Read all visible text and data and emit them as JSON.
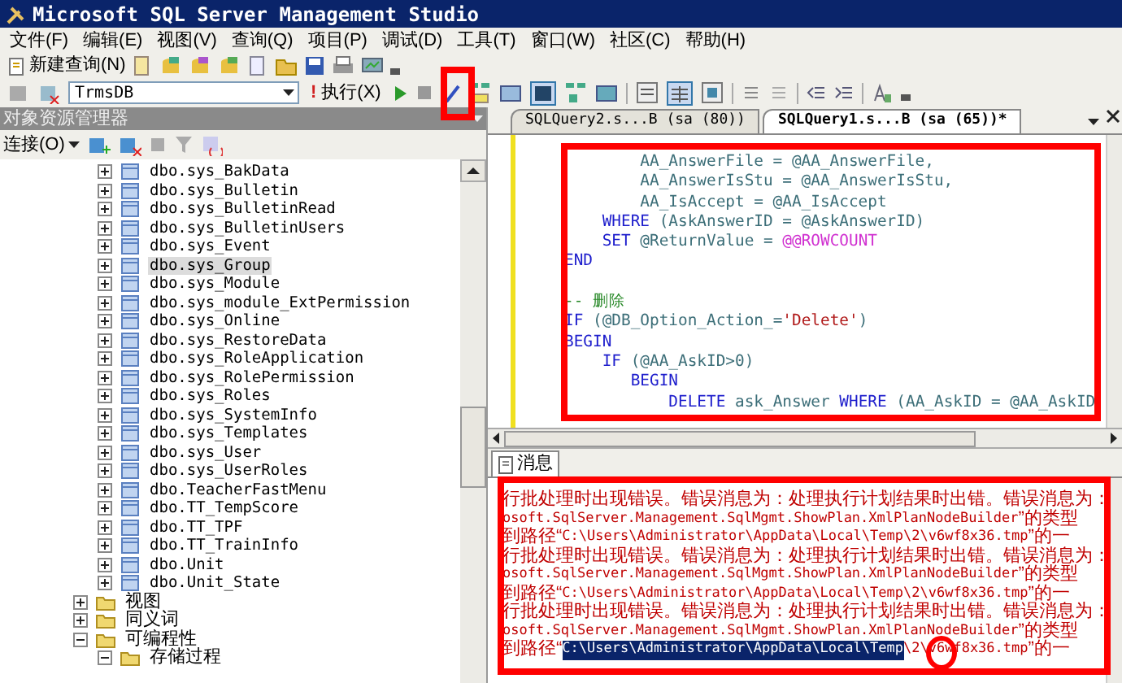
{
  "window": {
    "title": "Microsoft SQL Server Management Studio"
  },
  "menu": [
    "文件(F)",
    "编辑(E)",
    "视图(V)",
    "查询(Q)",
    "项目(P)",
    "调试(D)",
    "工具(T)",
    "窗口(W)",
    "社区(C)",
    "帮助(H)"
  ],
  "toolbar": {
    "new_query": "新建查询(N)",
    "database": "TrmsDB",
    "execute_mark": "!",
    "execute": "执行(X)"
  },
  "object_explorer": {
    "title": "对象资源管理器",
    "connect": "连接(O)",
    "tables": [
      {
        "label": "dbo.sys_BakData",
        "expanded": false,
        "selected": false
      },
      {
        "label": "dbo.sys_Bulletin",
        "expanded": false,
        "selected": false
      },
      {
        "label": "dbo.sys_BulletinRead",
        "expanded": false,
        "selected": false
      },
      {
        "label": "dbo.sys_BulletinUsers",
        "expanded": false,
        "selected": false
      },
      {
        "label": "dbo.sys_Event",
        "expanded": false,
        "selected": false
      },
      {
        "label": "dbo.sys_Group",
        "expanded": false,
        "selected": true
      },
      {
        "label": "dbo.sys_Module",
        "expanded": false,
        "selected": false
      },
      {
        "label": "dbo.sys_module_ExtPermission",
        "expanded": false,
        "selected": false
      },
      {
        "label": "dbo.sys_Online",
        "expanded": false,
        "selected": false
      },
      {
        "label": "dbo.sys_RestoreData",
        "expanded": false,
        "selected": false
      },
      {
        "label": "dbo.sys_RoleApplication",
        "expanded": false,
        "selected": false
      },
      {
        "label": "dbo.sys_RolePermission",
        "expanded": false,
        "selected": false
      },
      {
        "label": "dbo.sys_Roles",
        "expanded": false,
        "selected": false
      },
      {
        "label": "dbo.sys_SystemInfo",
        "expanded": false,
        "selected": false
      },
      {
        "label": "dbo.sys_Templates",
        "expanded": false,
        "selected": false
      },
      {
        "label": "dbo.sys_User",
        "expanded": false,
        "selected": false
      },
      {
        "label": "dbo.sys_UserRoles",
        "expanded": false,
        "selected": false
      },
      {
        "label": "dbo.TeacherFastMenu",
        "expanded": false,
        "selected": false
      },
      {
        "label": "dbo.TT_TempScore",
        "expanded": false,
        "selected": false
      },
      {
        "label": "dbo.TT_TPF",
        "expanded": false,
        "selected": false
      },
      {
        "label": "dbo.TT_TrainInfo",
        "expanded": false,
        "selected": false
      },
      {
        "label": "dbo.Unit",
        "expanded": false,
        "selected": false
      },
      {
        "label": "dbo.Unit_State",
        "expanded": false,
        "selected": false
      }
    ],
    "folders": [
      {
        "label": "视图",
        "expanded": false
      },
      {
        "label": "同义词",
        "expanded": false
      },
      {
        "label": "可编程性",
        "expanded": true,
        "children": [
          {
            "label": "存储过程",
            "expanded": true
          }
        ]
      }
    ]
  },
  "editor": {
    "tabs": [
      {
        "label": "SQLQuery2.s...B (sa (80))",
        "selected": false
      },
      {
        "label": "SQLQuery1.s...B (sa (65))*",
        "selected": true
      }
    ],
    "lines": [
      {
        "kind": "code",
        "tokens": [
          {
            "kind": "plain",
            "text": "        AA_AnswerFile = @AA_AnswerFile,"
          }
        ]
      },
      {
        "kind": "code",
        "tokens": [
          {
            "kind": "plain",
            "text": "        AA_AnswerIsStu = @AA_AnswerIsStu,"
          }
        ]
      },
      {
        "kind": "code",
        "tokens": [
          {
            "kind": "plain",
            "text": "        AA_IsAccept = @AA_IsAccept"
          }
        ]
      },
      {
        "kind": "code",
        "tokens": [
          {
            "kind": "keyword",
            "text": "    WHERE"
          },
          {
            "kind": "plain",
            "text": " (AskAnswerID = @AskAnswerID)"
          }
        ]
      },
      {
        "kind": "code",
        "tokens": [
          {
            "kind": "keyword",
            "text": "    SET"
          },
          {
            "kind": "plain",
            "text": " @ReturnValue = "
          },
          {
            "kind": "system",
            "text": "@@ROWCOUNT"
          }
        ]
      },
      {
        "kind": "code",
        "tokens": [
          {
            "kind": "keyword",
            "text": "END"
          }
        ]
      },
      {
        "kind": "blank"
      },
      {
        "kind": "code",
        "tokens": [
          {
            "kind": "comment",
            "text": "-- 删除"
          }
        ]
      },
      {
        "kind": "code",
        "tokens": [
          {
            "kind": "keyword",
            "text": "IF"
          },
          {
            "kind": "plain",
            "text": " (@DB_Option_Action_="
          },
          {
            "kind": "string",
            "text": "'Delete'"
          },
          {
            "kind": "plain",
            "text": ")"
          }
        ]
      },
      {
        "kind": "code",
        "tokens": [
          {
            "kind": "keyword",
            "text": "BEGIN"
          }
        ]
      },
      {
        "kind": "code",
        "tokens": [
          {
            "kind": "keyword",
            "text": "    IF"
          },
          {
            "kind": "plain",
            "text": " (@AA_AskID>0)"
          }
        ]
      },
      {
        "kind": "code",
        "tokens": [
          {
            "kind": "keyword",
            "text": "       BEGIN"
          }
        ]
      },
      {
        "kind": "code",
        "tokens": [
          {
            "kind": "keyword",
            "text": "           DELETE"
          },
          {
            "kind": "plain",
            "text": " ask_Answer "
          },
          {
            "kind": "keyword",
            "text": "WHERE"
          },
          {
            "kind": "plain",
            "text": " (AA_AskID = @AA_AskID"
          }
        ]
      }
    ]
  },
  "messages": {
    "tab": "消息",
    "lines": [
      {
        "segments": [
          {
            "kind": "cjk",
            "text": "行批处理时出现错误。错误消息为：处理执行计划结果时出错。错误消息为：",
            "selected": false
          }
        ]
      },
      {
        "segments": [
          {
            "kind": "code",
            "text": "osoft.SqlServer.Management.SqlMgmt.ShowPlan.XmlPlanNodeBuilder",
            "selected": false
          },
          {
            "kind": "cjk",
            "text": "”的类型",
            "selected": false
          }
        ]
      },
      {
        "segments": [
          {
            "kind": "cjk",
            "text": "到路径“",
            "selected": false
          },
          {
            "kind": "code",
            "text": "C:\\Users\\Administrator\\AppData\\Local\\Temp\\2\\v6wf8x36.tmp",
            "selected": false
          },
          {
            "kind": "cjk",
            "text": "”的一",
            "selected": false
          }
        ]
      },
      {
        "segments": [
          {
            "kind": "cjk",
            "text": "行批处理时出现错误。错误消息为：处理执行计划结果时出错。错误消息为：",
            "selected": false
          }
        ]
      },
      {
        "segments": [
          {
            "kind": "code",
            "text": "osoft.SqlServer.Management.SqlMgmt.ShowPlan.XmlPlanNodeBuilder",
            "selected": false
          },
          {
            "kind": "cjk",
            "text": "”的类型",
            "selected": false
          }
        ]
      },
      {
        "segments": [
          {
            "kind": "cjk",
            "text": "到路径“",
            "selected": false
          },
          {
            "kind": "code",
            "text": "C:\\Users\\Administrator\\AppData\\Local\\Temp\\2\\v6wf8x36.tmp",
            "selected": false
          },
          {
            "kind": "cjk",
            "text": "”的一",
            "selected": false
          }
        ]
      },
      {
        "segments": [
          {
            "kind": "cjk",
            "text": "行批处理时出现错误。错误消息为：处理执行计划结果时出错。错误消息为：",
            "selected": false
          }
        ]
      },
      {
        "segments": [
          {
            "kind": "code",
            "text": "osoft.SqlServer.Management.SqlMgmt.ShowPlan.XmlPlanNodeBuilder",
            "selected": false
          },
          {
            "kind": "cjk",
            "text": "”的类型",
            "selected": false
          }
        ]
      },
      {
        "segments": [
          {
            "kind": "cjk",
            "text": "到路径“",
            "selected": false
          },
          {
            "kind": "code",
            "text": "C:\\Users\\Administrator\\AppData\\Local\\Temp",
            "selected": true
          },
          {
            "kind": "code",
            "text": "\\2\\v6wf8x36.tmp",
            "selected": false
          },
          {
            "kind": "cjk",
            "text": "”的一",
            "selected": false
          }
        ]
      }
    ]
  }
}
